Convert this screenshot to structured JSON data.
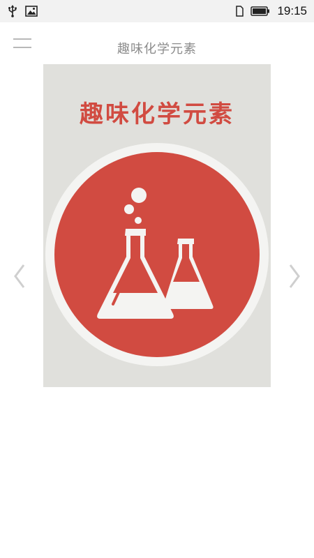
{
  "status_bar": {
    "time": "19:15",
    "icons": [
      "usb-icon",
      "image-icon",
      "sim-icon",
      "battery-icon"
    ]
  },
  "header": {
    "title": "趣味化学元素",
    "menu_icon": "hamburger-menu-icon"
  },
  "carousel": {
    "prev_icon": "chevron-left-icon",
    "next_icon": "chevron-right-icon",
    "slide": {
      "heading": "趣味化学元素",
      "icon": "lab-flasks-icon"
    }
  },
  "colors": {
    "accent_red": "#d14b41",
    "image_background": "#e0e0dc",
    "circle_ring": "#f4f4f2",
    "title_gray": "#8c8c8c"
  }
}
